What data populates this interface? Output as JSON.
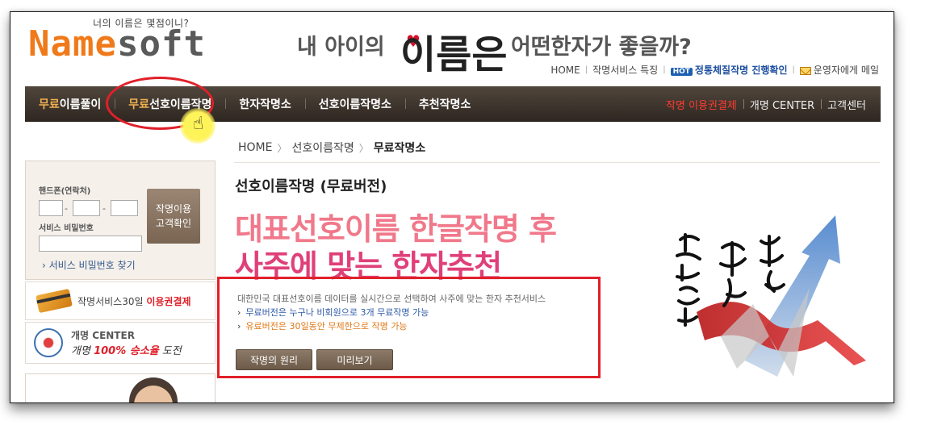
{
  "header": {
    "tagline": "너의 이름은 몇점이니?",
    "logo_part1": "Name",
    "logo_part2": "soft",
    "banner_left": "내 아이의",
    "banner_brush": "이름은",
    "banner_right": "어떤한자가 좋을까?",
    "top_links": {
      "home": "HOME",
      "feature": "작명서비스 특징",
      "hot_badge": "HOT",
      "progress": "정통체질작명 진행확인",
      "mail": "운영자에게 메일"
    }
  },
  "mainnav": {
    "items": [
      {
        "prefix": "무료",
        "label": "이름풀이"
      },
      {
        "prefix": "무료",
        "label": "선호이름작명"
      },
      {
        "prefix": "",
        "label": "한자작명소"
      },
      {
        "prefix": "",
        "label": "선호이름작명소"
      },
      {
        "prefix": "",
        "label": "추천작명소"
      }
    ],
    "right": {
      "payment": "작명 이용권결제",
      "rename": "개명 CENTER",
      "support": "고객센터"
    }
  },
  "breadcrumb": {
    "home": "HOME",
    "section": "선호이름작명",
    "current": "무료작명소"
  },
  "sidebar": {
    "phone_label": "핸드폰(연락처)",
    "dash": "-",
    "password_label": "서비스 비밀번호",
    "check_button": "작명이용\n고객확인",
    "find_password": "› 서비스 비밀번호 찾기",
    "promo_payment_prefix": "작명서비스30일 ",
    "promo_payment_highlight": "이용권결제",
    "promo_rename_title": "개명 CENTER",
    "promo_rename_prefix": "개명 ",
    "promo_rename_highlight": "100% 승소율",
    "promo_rename_suffix": " 도전"
  },
  "content": {
    "page_title": "선호이름작명 (무료버전)",
    "headline1": "대표선호이름 한글작명 후",
    "headline2": "사주에 맞는 한자추천",
    "description": "대한민국 대표선호이름 데이터를 실시간으로 선택하여 사주에 맞는 한자 추천서비스",
    "bullet_free": "무료버전은 누구나 비회원으로 3개 무료작명 가능",
    "bullet_paid": "유료버전은 30일동안 무제한으로 작명 가능",
    "bullet_arrow": "›",
    "button_principle": "작명의 원리",
    "button_preview": "미리보기"
  },
  "colors": {
    "accent_red": "#e0202a",
    "logo_orange": "#f07a1a",
    "nav_brown": "#3a3028",
    "headline_pink": "#f0788a"
  }
}
